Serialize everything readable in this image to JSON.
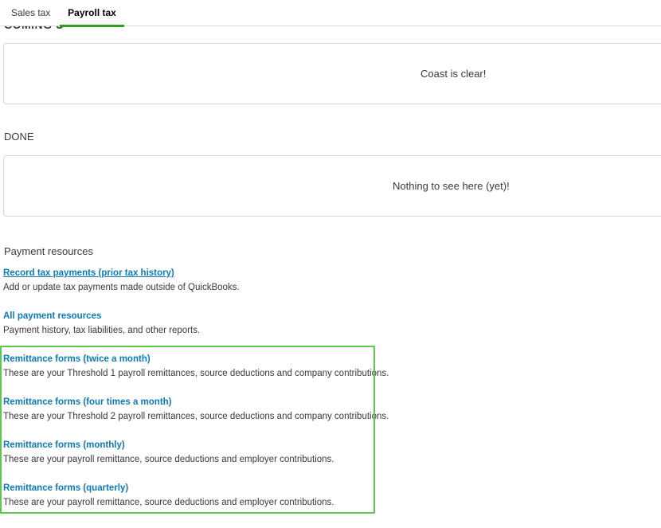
{
  "tabs": [
    {
      "label": "Sales tax"
    },
    {
      "label": "Payroll tax"
    }
  ],
  "coming": {
    "heading": "COMING U",
    "empty_message": "Coast is clear!"
  },
  "done": {
    "heading": "DONE",
    "empty_message": "Nothing to see here (yet)!"
  },
  "payment_resources": {
    "title": "Payment resources",
    "items": [
      {
        "link": "Record tax payments (prior tax history)",
        "description": "Add or update tax payments made outside of QuickBooks."
      },
      {
        "link": "All payment resources",
        "description": "Payment history, tax liabilities, and other reports."
      },
      {
        "link": "Remittance forms (twice a month)",
        "description": "These are your Threshold 1 payroll remittances, source deductions and company contributions."
      },
      {
        "link": "Remittance forms (four times a month)",
        "description": "These are your Threshold 2 payroll remittances, source deductions and company contributions."
      },
      {
        "link": "Remittance forms (monthly)",
        "description": "These are your payroll remittance, source deductions and employer contributions."
      },
      {
        "link": "Remittance forms (quarterly)",
        "description": "These are your payroll remittance, source deductions and employer contributions."
      }
    ]
  },
  "colors": {
    "accent_green": "#2ca01c",
    "link_blue": "#0d7ab8",
    "highlight_green": "#5cc94d"
  }
}
